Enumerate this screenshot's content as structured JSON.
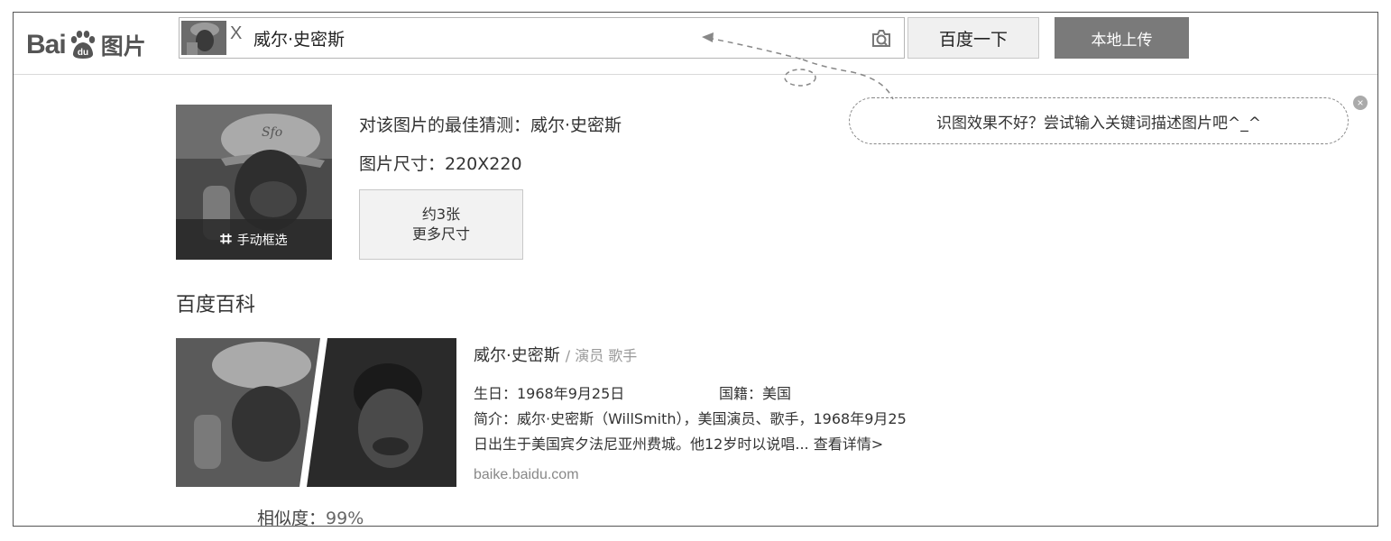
{
  "logo": {
    "bai": "Bai",
    "du": "du",
    "tupian": "图片"
  },
  "search": {
    "thumb_close": "X",
    "query": "威尔·史密斯",
    "camera_icon": "camera-icon",
    "search_button": "百度一下",
    "upload_button": "本地上传"
  },
  "hint": {
    "text": "识图效果不好？尝试输入关键词描述图片吧^_^",
    "close_icon": "close-icon"
  },
  "guess": {
    "crop_label": "手动框选",
    "best_guess": "对该图片的最佳猜测：威尔·史密斯",
    "image_size": "图片尺寸：220X220",
    "more_count": "约3张",
    "more_label": "更多尺寸"
  },
  "baike": {
    "heading": "百度百科",
    "name": "威尔·史密斯",
    "tags": "/ 演员 歌手",
    "birthday": "生日：1968年9月25日",
    "nationality": "国籍：美国",
    "intro_line1": "简介：威尔·史密斯（WillSmith），美国演员、歌手，1968年9月25",
    "intro_line2": "日出生于美国宾夕法尼亚州费城。他12岁时以说唱...",
    "more_link": "查看详情>",
    "url": "baike.baidu.com",
    "similarity_label": "相似度：",
    "similarity_value": "99%"
  },
  "colors": {
    "upload_bg": "#7a7a7a",
    "search_btn_bg": "#f0f0f0",
    "border": "#555555"
  }
}
